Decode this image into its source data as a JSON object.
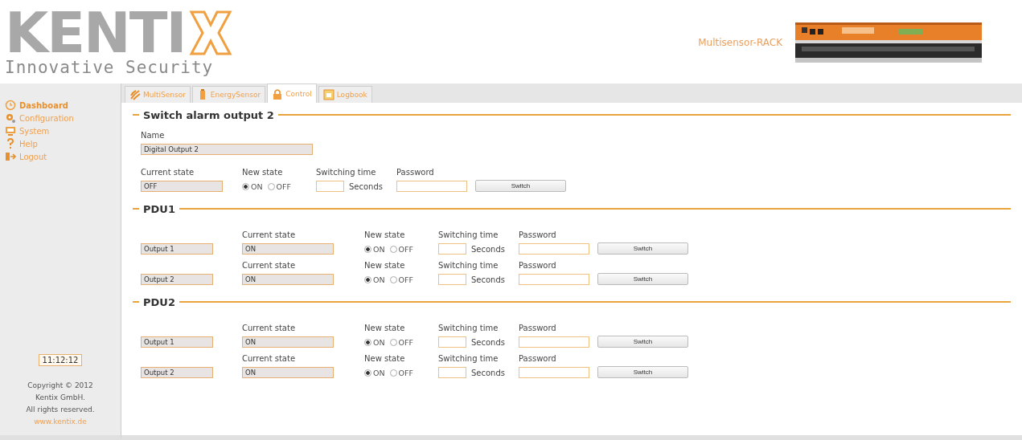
{
  "header": {
    "logo": {
      "wordmark": "KENTI",
      "tagline": "Innovative Security"
    },
    "device_name": "Multisensor-RACK"
  },
  "sidebar": {
    "items": [
      {
        "label": "Dashboard",
        "kind": "clock",
        "selected": true
      },
      {
        "label": "Configuration",
        "kind": "gear",
        "selected": false
      },
      {
        "label": "System",
        "kind": "monitor",
        "selected": false
      },
      {
        "label": "Help",
        "kind": "help",
        "selected": false
      },
      {
        "label": "Logout",
        "kind": "logout",
        "selected": false
      }
    ],
    "clock": "11:12:12",
    "copyright": [
      "Copyright © 2012",
      "Kentix GmbH.",
      "All rights reserved."
    ],
    "link": "www.kentix.de"
  },
  "tabs": [
    {
      "label": "MultiSensor",
      "kind": "waves",
      "selected": false
    },
    {
      "label": "EnergySensor",
      "kind": "battery",
      "selected": false
    },
    {
      "label": "Control",
      "kind": "lock",
      "selected": true
    },
    {
      "label": "Logbook",
      "kind": "calendar",
      "selected": false
    }
  ],
  "sections": [
    {
      "title": "Switch alarm output 2",
      "kind": "single",
      "name_label": "Name",
      "name_value": "Digital Output 2",
      "rows": [
        {
          "current_label": "Current state",
          "current_value": "OFF",
          "new_state_label": "New state",
          "options": [
            {
              "label": "ON",
              "selected": true
            },
            {
              "label": "OFF",
              "selected": false
            }
          ],
          "time_label": "Switching time",
          "unit": "Seconds",
          "password_label": "Password",
          "button": "Switch"
        }
      ]
    },
    {
      "title": "PDU1",
      "kind": "pdu",
      "rows": [
        {
          "output": "Output 1",
          "current_label": "Current state",
          "current_value": "ON",
          "new_state_label": "New state",
          "options": [
            {
              "label": "ON",
              "selected": true
            },
            {
              "label": "OFF",
              "selected": false
            }
          ],
          "time_label": "Switching time",
          "unit": "Seconds",
          "password_label": "Password",
          "button": "Switch"
        },
        {
          "output": "Output 2",
          "current_label": "Current state",
          "current_value": "ON",
          "new_state_label": "New state",
          "options": [
            {
              "label": "ON",
              "selected": true
            },
            {
              "label": "OFF",
              "selected": false
            }
          ],
          "time_label": "Switching time",
          "unit": "Seconds",
          "password_label": "Password",
          "button": "Switch"
        }
      ]
    },
    {
      "title": "PDU2",
      "kind": "pdu",
      "rows": [
        {
          "output": "Output 1",
          "current_label": "Current state",
          "current_value": "ON",
          "new_state_label": "New state",
          "options": [
            {
              "label": "ON",
              "selected": true
            },
            {
              "label": "OFF",
              "selected": false
            }
          ],
          "time_label": "Switching time",
          "unit": "Seconds",
          "password_label": "Password",
          "button": "Switch"
        },
        {
          "output": "Output 2",
          "current_label": "Current state",
          "current_value": "ON",
          "new_state_label": "New state",
          "options": [
            {
              "label": "ON",
              "selected": true
            },
            {
              "label": "OFF",
              "selected": false
            }
          ],
          "time_label": "Switching time",
          "unit": "Seconds",
          "password_label": "Password",
          "button": "Switch"
        }
      ]
    }
  ]
}
